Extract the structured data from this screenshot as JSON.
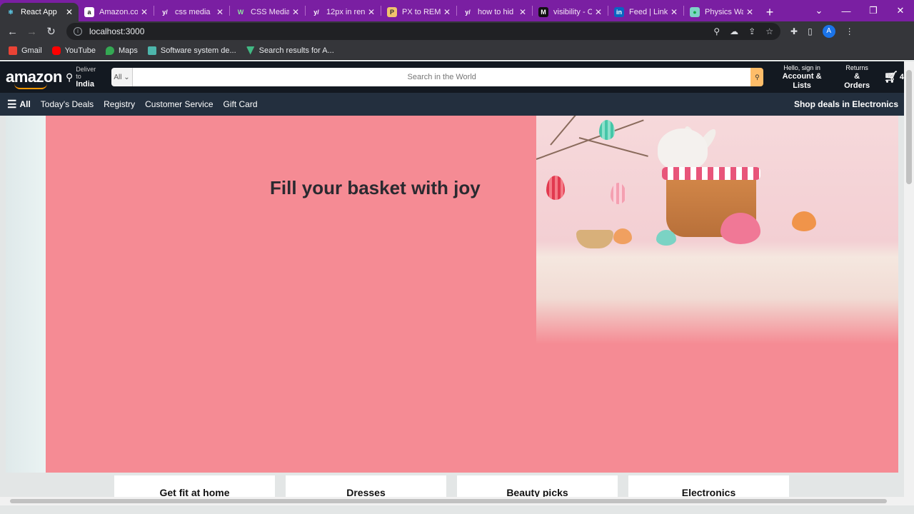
{
  "browser": {
    "tabs": [
      {
        "title": "React App",
        "active": true
      },
      {
        "title": "Amazon.co",
        "active": false
      },
      {
        "title": "css media",
        "active": false
      },
      {
        "title": "CSS Media",
        "active": false
      },
      {
        "title": "12px in ren",
        "active": false
      },
      {
        "title": "PX to REM",
        "active": false
      },
      {
        "title": "how to hid",
        "active": false
      },
      {
        "title": "visibility - C",
        "active": false
      },
      {
        "title": "Feed | Link",
        "active": false
      },
      {
        "title": "Physics Wa",
        "active": false
      }
    ],
    "url": "localhost:3000",
    "avatar_letter": "A",
    "bookmarks": [
      "Gmail",
      "YouTube",
      "Maps",
      "Software system de...",
      "Search results for A..."
    ]
  },
  "amazon": {
    "logo": "amazon",
    "deliver_label": "Deliver to",
    "deliver_location": "India",
    "search_category": "All",
    "search_placeholder": "Search in the World",
    "account_line1": "Hello, sign in",
    "account_line2": "Account & Lists",
    "returns_line1": "Returns",
    "returns_line2": "& Orders",
    "cart_count": "4",
    "nav": {
      "all": "All",
      "items": [
        "Today's Deals",
        "Registry",
        "Customer Service",
        "Gift Card"
      ],
      "right": "Shop deals in Electronics"
    },
    "hero_title": "Fill your basket with joy",
    "cards": [
      "Get fit at home",
      "Dresses",
      "Beauty picks",
      "Electronics"
    ]
  },
  "colors": {
    "tab_bar": "#7a1fa2",
    "amazon_header": "#131921",
    "amazon_nav": "#232f3e",
    "hero": "#f58b94",
    "search_button": "#febd69"
  }
}
